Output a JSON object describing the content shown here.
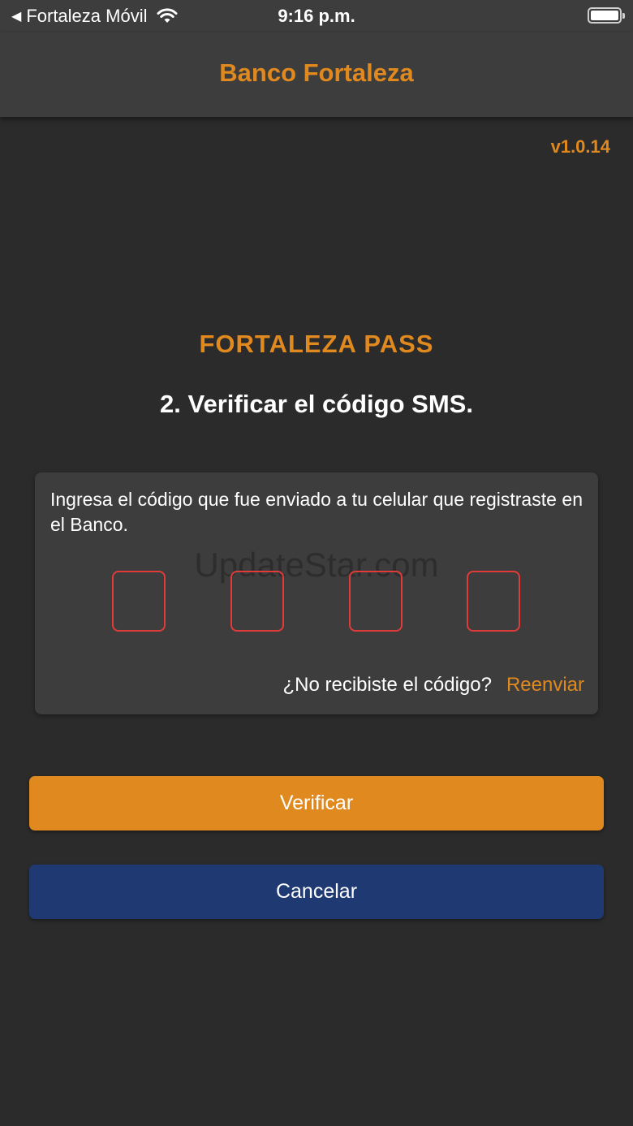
{
  "status_bar": {
    "carrier": "Fortaleza Móvil",
    "time": "9:16 p.m."
  },
  "header": {
    "title": "Banco Fortaleza"
  },
  "version": "v1.0.14",
  "main": {
    "brand": "FORTALEZA PASS",
    "step_title": "2. Verificar el código SMS.",
    "instruction": "Ingresa el código que fue enviado a tu celular que registraste en el Banco.",
    "watermark": "UpdateStar.com",
    "code_digits": [
      "",
      "",
      "",
      ""
    ],
    "resend_question": "¿No recibiste el código?",
    "resend_link": "Reenviar"
  },
  "buttons": {
    "verify": "Verificar",
    "cancel": "Cancelar"
  },
  "colors": {
    "accent": "#e0891f",
    "cancel": "#1f3a72",
    "code_border": "#e03b3b",
    "background": "#2b2b2b",
    "surface": "#3d3d3d"
  }
}
